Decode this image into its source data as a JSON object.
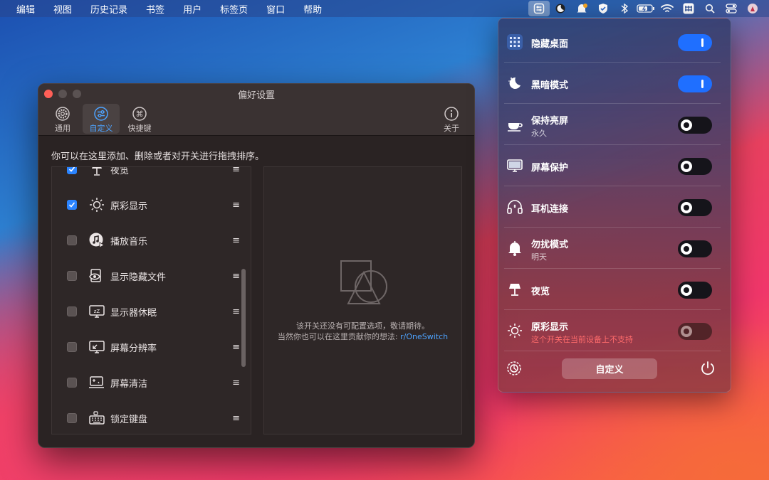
{
  "menubar": {
    "menus": [
      "编辑",
      "视图",
      "历史记录",
      "书签",
      "用户",
      "标签页",
      "窗口",
      "帮助"
    ],
    "status_icons": [
      "oneswitch-icon",
      "moon-app-icon",
      "notification-icon",
      "shield-icon",
      "bluetooth-icon",
      "battery-icon",
      "wifi-icon",
      "input-method-icon",
      "search-icon",
      "control-center-icon",
      "avatar-icon"
    ]
  },
  "prefs": {
    "title": "偏好设置",
    "tabs": [
      {
        "label": "通用",
        "icon": "gear-icon"
      },
      {
        "label": "自定义",
        "icon": "sliders-icon",
        "selected": true
      },
      {
        "label": "快捷键",
        "icon": "command-icon"
      }
    ],
    "about_label": "关于",
    "description": "你可以在这里添加、删除或者对开关进行拖拽排序。",
    "items": [
      {
        "label": "夜览",
        "checked": true,
        "icon": "lamp-icon"
      },
      {
        "label": "原彩显示",
        "checked": true,
        "icon": "sun-icon"
      },
      {
        "label": "播放音乐",
        "checked": false,
        "icon": "music-icon"
      },
      {
        "label": "显示隐藏文件",
        "checked": false,
        "icon": "eye-icon"
      },
      {
        "label": "显示器休眠",
        "checked": false,
        "icon": "display-sleep-icon"
      },
      {
        "label": "屏幕分辨率",
        "checked": false,
        "icon": "resolution-icon"
      },
      {
        "label": "屏幕清洁",
        "checked": false,
        "icon": "screen-clean-icon"
      },
      {
        "label": "锁定键盘",
        "checked": false,
        "icon": "keyboard-icon"
      }
    ],
    "drag_handle": "≡",
    "empty_msg_line1": "该开关还没有可配置选项，敬请期待。",
    "empty_msg_line2": "当然你也可以在这里贡献你的想法:",
    "empty_link": "r/OneSwitch"
  },
  "panel": {
    "rows": [
      {
        "name": "隐藏桌面",
        "sub": "",
        "state": "on",
        "icon": "grid-icon"
      },
      {
        "name": "黑暗模式",
        "sub": "",
        "state": "on",
        "icon": "moon-icon"
      },
      {
        "name": "保持亮屏",
        "sub": "永久",
        "state": "off",
        "icon": "coffee-icon"
      },
      {
        "name": "屏幕保护",
        "sub": "",
        "state": "off",
        "icon": "monitor-icon"
      },
      {
        "name": "耳机连接",
        "sub": "",
        "state": "off",
        "icon": "headphones-icon"
      },
      {
        "name": "勿扰模式",
        "sub": "明天",
        "state": "off",
        "icon": "bell-icon"
      },
      {
        "name": "夜览",
        "sub": "",
        "state": "off",
        "icon": "lamp-icon"
      },
      {
        "name": "原彩显示",
        "sub": "这个开关在当前设备上不支持",
        "state": "disabled",
        "icon": "sun-icon"
      }
    ],
    "customize_label": "自定义",
    "accent_color": "#1f6fff",
    "warn_color": "#ff6b6b"
  }
}
